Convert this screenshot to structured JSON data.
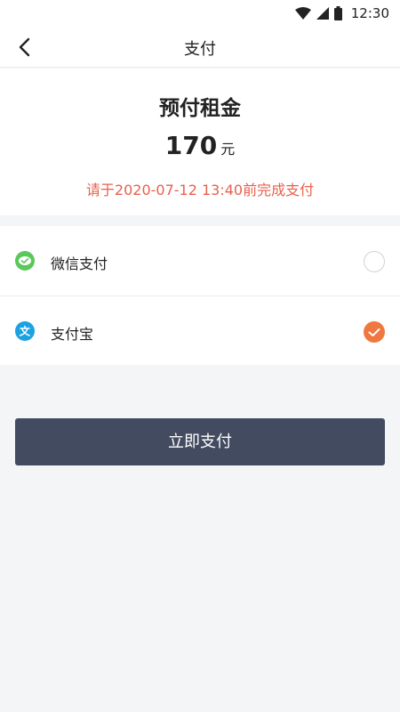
{
  "status_bar": {
    "time": "12:30",
    "icons": [
      "wifi-icon",
      "signal-icon",
      "battery-icon"
    ]
  },
  "nav": {
    "title": "支付",
    "back_icon": "chevron-left-icon"
  },
  "summary": {
    "title": "预付租金",
    "amount": "170",
    "unit": "元",
    "deadline": "请于2020-07-12 13:40前完成支付"
  },
  "payment_methods": [
    {
      "label": "微信支付",
      "icon": "wechat-pay-icon",
      "color": "#5ac85a",
      "selected": false
    },
    {
      "label": "支付宝",
      "icon": "alipay-icon",
      "color": "#1ba2e0",
      "selected": true
    }
  ],
  "pay_button": {
    "label": "立即支付"
  },
  "colors": {
    "accent": "#f0783f",
    "deadline": "#e8604c",
    "button": "#434b61"
  }
}
